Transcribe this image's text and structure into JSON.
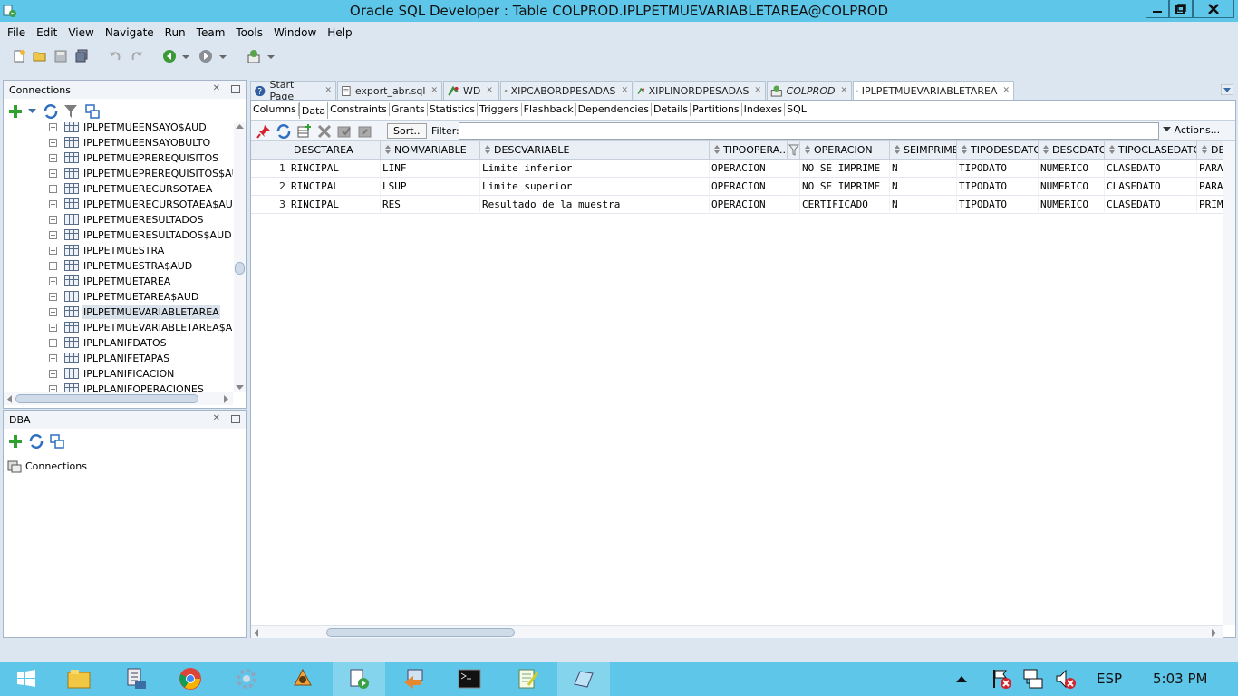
{
  "window": {
    "title": "Oracle SQL Developer : Table COLPROD.IPLPETMUEVARIABLETAREA@COLPROD"
  },
  "menu": [
    "File",
    "Edit",
    "View",
    "Navigate",
    "Run",
    "Team",
    "Tools",
    "Window",
    "Help"
  ],
  "connections_panel": {
    "title": "Connections",
    "tree_items": [
      "IPLPETMUEENSAYO$AUD",
      "IPLPETMUEENSAYOBULTO",
      "IPLPETMUEPREREQUISITOS",
      "IPLPETMUEPREREQUISITOS$AUD",
      "IPLPETMUERECURSOTAEA",
      "IPLPETMUERECURSOTAEA$AUD",
      "IPLPETMUERESULTADOS",
      "IPLPETMUERESULTADOS$AUD",
      "IPLPETMUESTRA",
      "IPLPETMUESTRA$AUD",
      "IPLPETMUETAREA",
      "IPLPETMUETAREA$AUD",
      "IPLPETMUEVARIABLETAREA",
      "IPLPETMUEVARIABLETAREA$AUD",
      "IPLPLANIFDATOS",
      "IPLPLANIFETAPAS",
      "IPLPLANIFICACION",
      "IPLPLANIFOPERACIONES"
    ],
    "selected_item": "IPLPETMUEVARIABLETAREA"
  },
  "dba_panel": {
    "title": "DBA",
    "item": "Connections"
  },
  "editor_tabs": [
    {
      "label": "Start Page",
      "icon": "help-icon"
    },
    {
      "label": "export_abr.sql",
      "icon": "sql-file-icon"
    },
    {
      "label": "WD",
      "icon": "connection-icon"
    },
    {
      "label": "XIPCABORDPESADAS",
      "icon": "connection-icon"
    },
    {
      "label": "XIPLINORDPESADAS",
      "icon": "connection-icon"
    },
    {
      "label": "COLPROD",
      "icon": "sql-worksheet-icon"
    },
    {
      "label": "IPLPETMUEVARIABLETAREA",
      "icon": "table-icon"
    }
  ],
  "sub_tabs": [
    "Columns",
    "Data",
    "Constraints",
    "Grants",
    "Statistics",
    "Triggers",
    "Flashback",
    "Dependencies",
    "Details",
    "Partitions",
    "Indexes",
    "SQL"
  ],
  "active_sub_tab": "Data",
  "data_toolbar": {
    "sort_label": "Sort..",
    "filter_label": "Filter:",
    "filter_value": "",
    "actions_label": "Actions..."
  },
  "grid": {
    "columns": [
      "DESCTAREA",
      "NOMVARIABLE",
      "DESCVARIABLE",
      "TIPOOPERA...",
      "OPERACION",
      "SEIMPRIME",
      "TIPODESDATO",
      "DESCDATO",
      "TIPOCLASEDATO",
      "DE"
    ],
    "rows": [
      {
        "num": "1",
        "cells": [
          "RINCIPAL",
          "LINF",
          "Limite inferior",
          "OPERACION",
          "NO SE IMPRIME",
          "N",
          "TIPODATO",
          "NUMERICO",
          "CLASEDATO",
          "PARA"
        ]
      },
      {
        "num": "2",
        "cells": [
          "RINCIPAL",
          "LSUP",
          "Limite superior",
          "OPERACION",
          "NO SE IMPRIME",
          "N",
          "TIPODATO",
          "NUMERICO",
          "CLASEDATO",
          "PARA"
        ]
      },
      {
        "num": "3",
        "cells": [
          "RINCIPAL",
          "RES",
          "Resultado de la muestra",
          "OPERACION",
          "CERTIFICADO",
          "N",
          "TIPODATO",
          "NUMERICO",
          "CLASEDATO",
          "PRIM"
        ]
      }
    ]
  },
  "taskbar": {
    "language": "ESP",
    "time": "5:03 PM"
  },
  "colors": {
    "titlebar": "#5ec6e8",
    "chrome": "#dbe6f1",
    "selection": "#d9e2ea"
  }
}
